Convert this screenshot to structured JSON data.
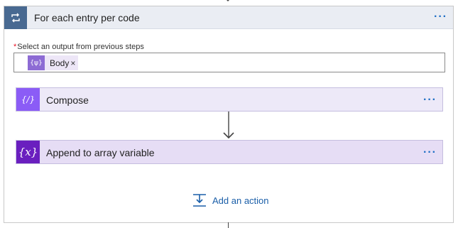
{
  "loop": {
    "title": "For each entry per code",
    "more_label": "···"
  },
  "select_output": {
    "required_marker": "*",
    "label": "Select an output from previous steps",
    "token": {
      "icon_text": "{ψ}",
      "label": "Body",
      "close_label": "×"
    }
  },
  "actions": [
    {
      "title": "Compose",
      "icon_text": "{∕}",
      "icon": "compose-icon",
      "color": "#8b5cf6",
      "more_label": "···"
    },
    {
      "title": "Append to array variable",
      "icon_text": "{x}",
      "icon": "variable-icon",
      "color": "#6a1fbf",
      "more_label": "···"
    }
  ],
  "add_action": {
    "label": "Add an action",
    "icon": "add-action-icon"
  },
  "colors": {
    "loop_header_bg": "#eaedf3",
    "loop_icon_bg": "#486991",
    "link": "#1a5ea8"
  }
}
